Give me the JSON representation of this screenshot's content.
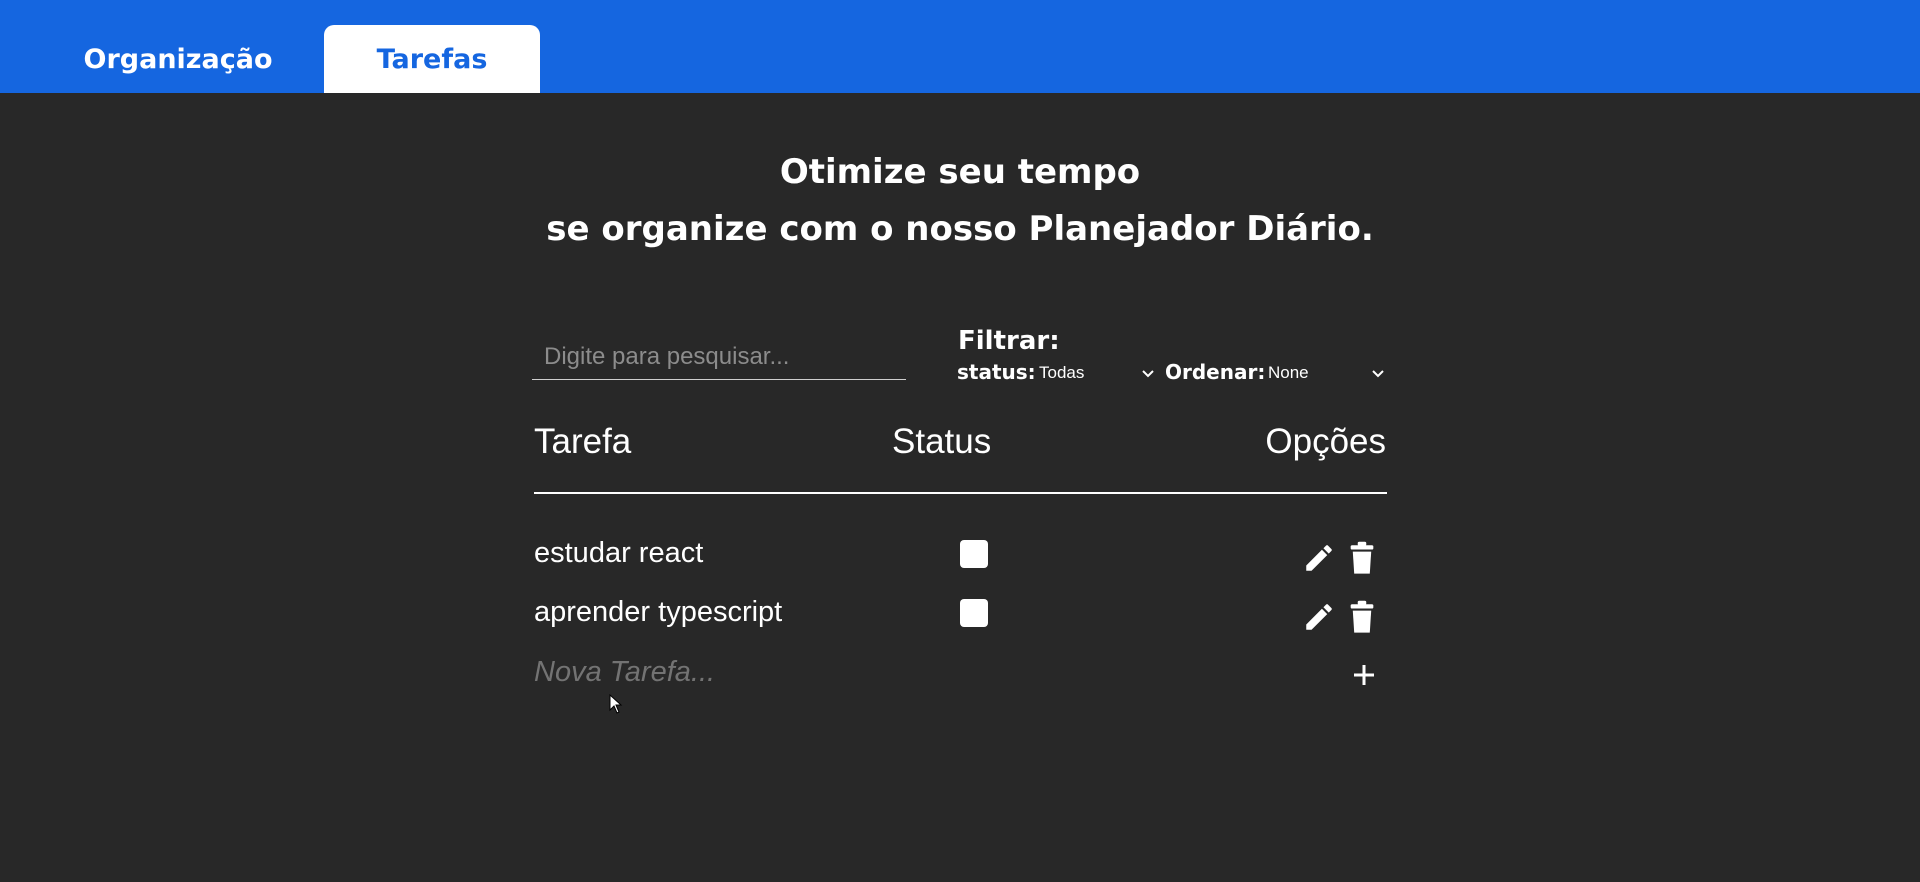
{
  "tabs": [
    {
      "label": "Organização",
      "active": false
    },
    {
      "label": "Tarefas",
      "active": true
    }
  ],
  "headline": {
    "line1": "Otimize seu tempo",
    "line2": "se organize com o nosso Planejador Diário."
  },
  "search": {
    "placeholder": "Digite para pesquisar...",
    "value": ""
  },
  "filter": {
    "title": "Filtrar:",
    "status_label": "status:",
    "status_value": "Todas",
    "order_label": "Ordenar:",
    "order_value": "None"
  },
  "table": {
    "headers": [
      "Tarefa",
      "Status",
      "Opções"
    ],
    "rows": [
      {
        "task": "estudar react",
        "done": false
      },
      {
        "task": "aprender typescript",
        "done": false
      }
    ]
  },
  "new_task": {
    "placeholder": "Nova Tarefa..."
  },
  "icons": {
    "edit": "pencil-icon",
    "delete": "trash-icon",
    "add": "plus-icon",
    "select": "chevron-down-icon"
  },
  "colors": {
    "header": "#1566e0",
    "background": "#282828",
    "text": "#ffffff",
    "placeholder": "#737373"
  }
}
